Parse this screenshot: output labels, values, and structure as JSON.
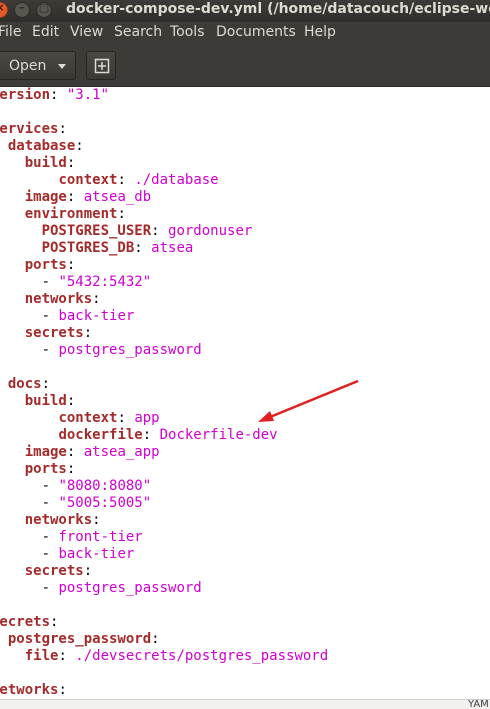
{
  "window": {
    "title": "docker-compose-dev.yml (/home/datacouch/eclipse-workspace",
    "close_glyph": "×",
    "min_glyph": "–",
    "max_glyph": "□"
  },
  "menubar": {
    "items": [
      "File",
      "Edit",
      "View",
      "Search",
      "Tools",
      "Documents",
      "Help"
    ]
  },
  "toolbar": {
    "open_label": "Open",
    "new_icon": "new-document-icon"
  },
  "colors": {
    "key": "#a52a2a",
    "value": "#d100d1",
    "chrome": "#3c3b37",
    "annotation_arrow": "#e02020"
  },
  "editor": {
    "lines": [
      [
        {
          "k": "version"
        },
        {
          "p": ": "
        },
        {
          "v": "\"3.1\""
        }
      ],
      [],
      [
        {
          "k": "services"
        },
        {
          "p": ":"
        }
      ],
      [
        {
          "p": "  "
        },
        {
          "k": "database"
        },
        {
          "p": ":"
        }
      ],
      [
        {
          "p": "    "
        },
        {
          "k": "build"
        },
        {
          "p": ":"
        }
      ],
      [
        {
          "p": "        "
        },
        {
          "k": "context"
        },
        {
          "p": ": "
        },
        {
          "v": "./database"
        }
      ],
      [
        {
          "p": "    "
        },
        {
          "k": "image"
        },
        {
          "p": ": "
        },
        {
          "v": "atsea_db"
        }
      ],
      [
        {
          "p": "    "
        },
        {
          "k": "environment"
        },
        {
          "p": ":"
        }
      ],
      [
        {
          "p": "      "
        },
        {
          "k": "POSTGRES_USER"
        },
        {
          "p": ": "
        },
        {
          "v": "gordonuser"
        }
      ],
      [
        {
          "p": "      "
        },
        {
          "k": "POSTGRES_DB"
        },
        {
          "p": ": "
        },
        {
          "v": "atsea"
        }
      ],
      [
        {
          "p": "    "
        },
        {
          "k": "ports"
        },
        {
          "p": ":"
        }
      ],
      [
        {
          "p": "      - "
        },
        {
          "v": "\"5432:5432\""
        }
      ],
      [
        {
          "p": "    "
        },
        {
          "k": "networks"
        },
        {
          "p": ":"
        }
      ],
      [
        {
          "p": "      - "
        },
        {
          "v": "back-tier"
        }
      ],
      [
        {
          "p": "    "
        },
        {
          "k": "secrets"
        },
        {
          "p": ":"
        }
      ],
      [
        {
          "p": "      - "
        },
        {
          "v": "postgres_password"
        }
      ],
      [],
      [
        {
          "p": "  "
        },
        {
          "k": "docs"
        },
        {
          "p": ":"
        }
      ],
      [
        {
          "p": "    "
        },
        {
          "k": "build"
        },
        {
          "p": ":"
        }
      ],
      [
        {
          "p": "        "
        },
        {
          "k": "context"
        },
        {
          "p": ": "
        },
        {
          "v": "app"
        }
      ],
      [
        {
          "p": "        "
        },
        {
          "k": "dockerfile"
        },
        {
          "p": ": "
        },
        {
          "v": "Dockerfile-dev"
        }
      ],
      [
        {
          "p": "    "
        },
        {
          "k": "image"
        },
        {
          "p": ": "
        },
        {
          "v": "atsea_app"
        }
      ],
      [
        {
          "p": "    "
        },
        {
          "k": "ports"
        },
        {
          "p": ":"
        }
      ],
      [
        {
          "p": "      - "
        },
        {
          "v": "\"8080:8080\""
        }
      ],
      [
        {
          "p": "      - "
        },
        {
          "v": "\"5005:5005\""
        }
      ],
      [
        {
          "p": "    "
        },
        {
          "k": "networks"
        },
        {
          "p": ":"
        }
      ],
      [
        {
          "p": "      - "
        },
        {
          "v": "front-tier"
        }
      ],
      [
        {
          "p": "      - "
        },
        {
          "v": "back-tier"
        }
      ],
      [
        {
          "p": "    "
        },
        {
          "k": "secrets"
        },
        {
          "p": ":"
        }
      ],
      [
        {
          "p": "      - "
        },
        {
          "v": "postgres_password"
        }
      ],
      [],
      [
        {
          "k": "secrets"
        },
        {
          "p": ":"
        }
      ],
      [
        {
          "p": "  "
        },
        {
          "k": "postgres_password"
        },
        {
          "p": ":"
        }
      ],
      [
        {
          "p": "    "
        },
        {
          "k": "file"
        },
        {
          "p": ": "
        },
        {
          "v": "./devsecrets/postgres_password"
        }
      ],
      [],
      [
        {
          "k": "networks"
        },
        {
          "p": ":"
        }
      ]
    ]
  },
  "statusbar": {
    "text": "YAM"
  }
}
